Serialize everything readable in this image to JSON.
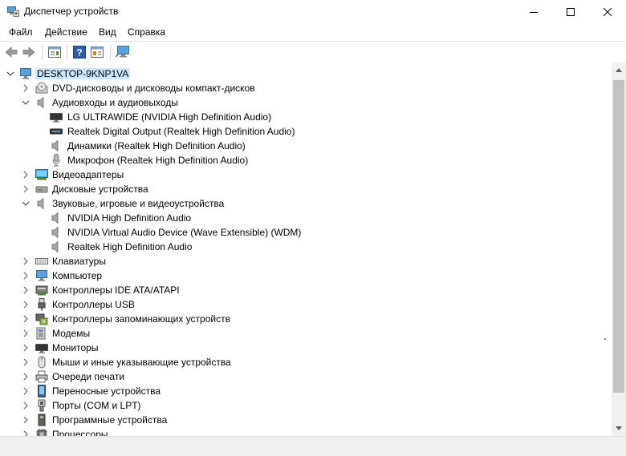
{
  "window": {
    "title": "Диспетчер устройств",
    "icon": "device-manager-icon"
  },
  "menu": [
    {
      "label": "Файл"
    },
    {
      "label": "Действие"
    },
    {
      "label": "Вид"
    },
    {
      "label": "Справка"
    }
  ],
  "toolbar": [
    {
      "name": "back-button",
      "icon": "arrow-left-icon"
    },
    {
      "name": "forward-button",
      "icon": "arrow-right-icon"
    },
    {
      "name": "properties-button",
      "icon": "properties-icon"
    },
    {
      "name": "help-button",
      "icon": "help-icon"
    },
    {
      "name": "view-button",
      "icon": "view-list-icon"
    },
    {
      "name": "scan-hardware-button",
      "icon": "monitor-icon"
    }
  ],
  "tree": {
    "root": {
      "label": "DESKTOP-9KNP1VA",
      "icon": "computer-icon",
      "expanded": true,
      "selected": true
    },
    "items": [
      {
        "label": "DVD-дисководы и дисководы компакт-дисков",
        "icon": "dvd-icon",
        "level": 1,
        "expander": "collapsed"
      },
      {
        "label": "Аудиовходы и аудиовыходы",
        "icon": "speaker-icon",
        "level": 1,
        "expander": "expanded"
      },
      {
        "label": "LG ULTRAWIDE (NVIDIA High Definition Audio)",
        "icon": "monitor-icon",
        "level": 2,
        "expander": "none"
      },
      {
        "label": "Realtek Digital Output (Realtek High Definition Audio)",
        "icon": "digital-output-icon",
        "level": 2,
        "expander": "none"
      },
      {
        "label": "Динамики (Realtek High Definition Audio)",
        "icon": "speaker-icon",
        "level": 2,
        "expander": "none"
      },
      {
        "label": "Микрофон (Realtek High Definition Audio)",
        "icon": "microphone-icon",
        "level": 2,
        "expander": "none"
      },
      {
        "label": "Видеоадаптеры",
        "icon": "display-adapter-icon",
        "level": 1,
        "expander": "collapsed"
      },
      {
        "label": "Дисковые устройства",
        "icon": "disk-drive-icon",
        "level": 1,
        "expander": "collapsed"
      },
      {
        "label": "Звуковые, игровые и видеоустройства",
        "icon": "speaker-icon",
        "level": 1,
        "expander": "expanded"
      },
      {
        "label": "NVIDIA High Definition Audio",
        "icon": "speaker-icon",
        "level": 2,
        "expander": "none"
      },
      {
        "label": "NVIDIA Virtual Audio Device (Wave Extensible) (WDM)",
        "icon": "speaker-icon",
        "level": 2,
        "expander": "none"
      },
      {
        "label": "Realtek High Definition Audio",
        "icon": "speaker-icon",
        "level": 2,
        "expander": "none"
      },
      {
        "label": "Клавиатуры",
        "icon": "keyboard-icon",
        "level": 1,
        "expander": "collapsed"
      },
      {
        "label": "Компьютер",
        "icon": "computer-icon",
        "level": 1,
        "expander": "collapsed"
      },
      {
        "label": "Контроллеры IDE ATA/ATAPI",
        "icon": "ide-controller-icon",
        "level": 1,
        "expander": "collapsed"
      },
      {
        "label": "Контроллеры USB",
        "icon": "usb-icon",
        "level": 1,
        "expander": "collapsed"
      },
      {
        "label": "Контроллеры запоминающих устройств",
        "icon": "storage-controller-icon",
        "level": 1,
        "expander": "collapsed"
      },
      {
        "label": "Модемы",
        "icon": "modem-icon",
        "level": 1,
        "expander": "collapsed"
      },
      {
        "label": "Мониторы",
        "icon": "monitor-icon",
        "level": 1,
        "expander": "collapsed"
      },
      {
        "label": "Мыши и иные указывающие устройства",
        "icon": "mouse-icon",
        "level": 1,
        "expander": "collapsed"
      },
      {
        "label": "Очереди печати",
        "icon": "printer-icon",
        "level": 1,
        "expander": "collapsed"
      },
      {
        "label": "Переносные устройства",
        "icon": "portable-device-icon",
        "level": 1,
        "expander": "collapsed"
      },
      {
        "label": "Порты (COM и LPT)",
        "icon": "port-icon",
        "level": 1,
        "expander": "collapsed"
      },
      {
        "label": "Программные устройства",
        "icon": "software-device-icon",
        "level": 1,
        "expander": "collapsed"
      },
      {
        "label": "Процессоры",
        "icon": "processor-icon",
        "level": 1,
        "expander": "collapsed"
      }
    ]
  },
  "colors": {
    "selection": "#cce8ff",
    "scrollbar_track": "#f0f0f0",
    "scrollbar_thumb": "#c2c2c2"
  }
}
